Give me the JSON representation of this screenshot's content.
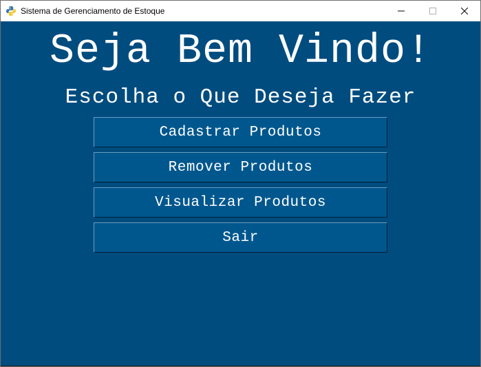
{
  "window": {
    "title": "Sistema de Gerenciamento de Estoque",
    "icon": "python-icon"
  },
  "main": {
    "heading": "Seja Bem Vindo!",
    "subheading": "Escolha o Que Deseja Fazer",
    "buttons": [
      {
        "label": "Cadastrar Produtos"
      },
      {
        "label": "Remover Produtos"
      },
      {
        "label": "Visualizar Produtos"
      },
      {
        "label": "Sair"
      }
    ]
  },
  "colors": {
    "background": "#004c7f",
    "button": "#00578e",
    "text": "#ffffff"
  }
}
